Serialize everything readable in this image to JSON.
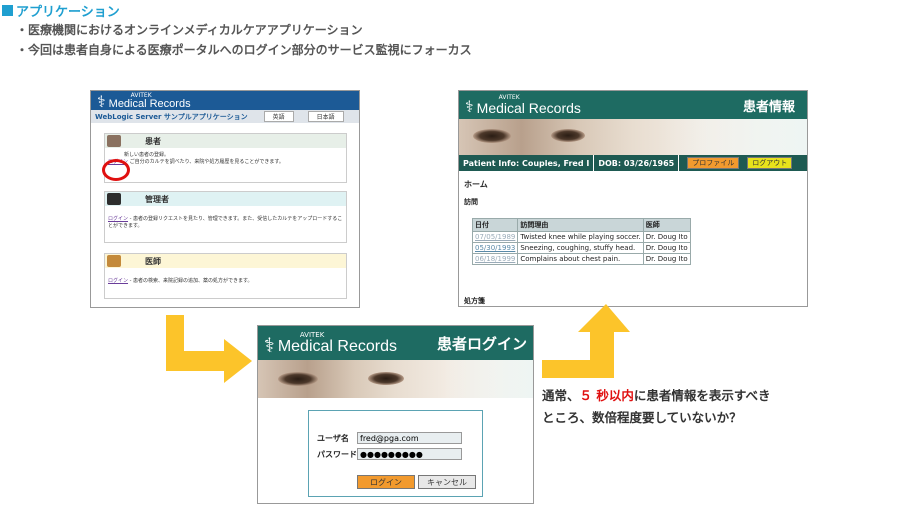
{
  "header": {
    "title": "アプリケーション",
    "bullets": [
      "・医療機関におけるオンラインメディカルケアアプリケーション",
      "・今回は患者自身による医療ポータルへのログイン部分のサービス監視にフォーカス"
    ]
  },
  "brand": {
    "small": "AVITEK",
    "big": "Medical Records"
  },
  "colors": {
    "accent": "#1f9fd0",
    "teal": "#1e6b62",
    "arrow": "#fcc42a",
    "highlight": "#e01010"
  },
  "panel1": {
    "subbar_title": "WebLogic Server サンプルアプリケーション",
    "lang_buttons": [
      "英語",
      "日本語"
    ],
    "roles": [
      {
        "heading": "患者",
        "link": "ログイン",
        "text": "新しい患者の登録。",
        "text2": "ご自分のカルテを調べたり、来院や処方履歴を見ることができます。"
      },
      {
        "heading": "管理者",
        "link": "ログイン",
        "text": "- 患者の登録リクエストを見たり、管理できます。また、受信したカルテをアップロードすることができます。"
      },
      {
        "heading": "医師",
        "link": "ログイン",
        "text": "- 患者の検索、来院記録の追加、薬の処方ができます。"
      }
    ]
  },
  "panel2": {
    "page_title": "患者情報",
    "patient_info": "Patient Info: Couples,  Fred  I",
    "dob": "DOB: 03/26/1965",
    "profile_button": "プロファイル",
    "logout_button": "ログアウト",
    "home": "ホーム",
    "visits_heading": "訪問",
    "table": {
      "headers": [
        "日付",
        "訪問理由",
        "医師"
      ],
      "rows": [
        [
          "07/05/1989",
          "Twisted knee while playing soccer.",
          "Dr. Doug Ito"
        ],
        [
          "05/30/1993",
          "Sneezing, coughing, stuffy head.",
          "Dr. Doug Ito"
        ],
        [
          "06/18/1999",
          "Complains about chest pain.",
          "Dr. Doug Ito"
        ]
      ]
    },
    "prescriptions_heading": "処方箋"
  },
  "panel3": {
    "page_title": "患者ログイン",
    "username_label": "ユーザ名",
    "username_value": "fred@pga.com",
    "password_label": "パスワード",
    "password_value": "●●●●●●●●●",
    "login_button": "ログイン",
    "cancel_button": "キャンセル"
  },
  "callout": {
    "line1_pre": "通常、",
    "line1_red": "５ 秒以内",
    "line1_post": "に患者情報を表示すべき",
    "line2": "ところ、数倍程度要していないか？"
  }
}
